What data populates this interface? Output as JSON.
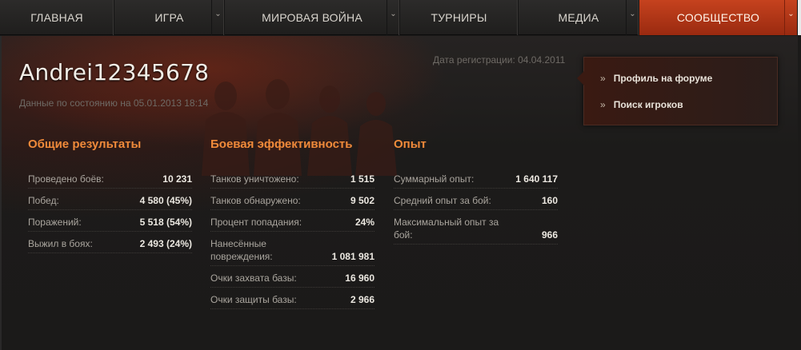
{
  "nav": {
    "items": [
      {
        "label": "ГЛАВНАЯ"
      },
      {
        "label": "ИГРА"
      },
      {
        "label": "МИРОВАЯ ВОЙНА"
      },
      {
        "label": "ТУРНИРЫ"
      },
      {
        "label": "МЕДИА"
      },
      {
        "label": "СООБЩЕСТВО"
      }
    ],
    "caret": "⌄",
    "accent_color": "#c6421e"
  },
  "profile": {
    "username": "Andrei12345678",
    "state_date": "Данные по состоянию на 05.01.2013 18:14",
    "registration": "Дата регистрации: 04.04.2011"
  },
  "side_menu": {
    "chevron": "»",
    "forum_profile": "Профиль на форуме",
    "player_search": "Поиск игроков"
  },
  "stats": {
    "general": {
      "title": "Общие результаты",
      "rows": [
        {
          "label": "Проведено боёв:",
          "value": "10 231"
        },
        {
          "label": "Побед:",
          "value": "4 580 (45%)"
        },
        {
          "label": "Поражений:",
          "value": "5 518 (54%)"
        },
        {
          "label": "Выжил в боях:",
          "value": "2 493 (24%)"
        }
      ]
    },
    "combat": {
      "title": "Боевая эффективность",
      "rows": [
        {
          "label": "Танков уничтожено:",
          "value": "1 515"
        },
        {
          "label": "Танков обнаружено:",
          "value": "9 502"
        },
        {
          "label": "Процент попадания:",
          "value": "24%"
        },
        {
          "label": "Нанесённые повреждения:",
          "value": "1 081 981"
        },
        {
          "label": "Очки захвата базы:",
          "value": "16 960"
        },
        {
          "label": "Очки защиты базы:",
          "value": "2 966"
        }
      ]
    },
    "experience": {
      "title": "Опыт",
      "rows": [
        {
          "label": "Суммарный опыт:",
          "value": "1 640 117"
        },
        {
          "label": "Средний опыт за бой:",
          "value": "160"
        },
        {
          "label": "Максимальный опыт за бой:",
          "value": "966"
        }
      ]
    }
  },
  "colors": {
    "heading": "#f08a3a",
    "background": "#1b1a19"
  }
}
